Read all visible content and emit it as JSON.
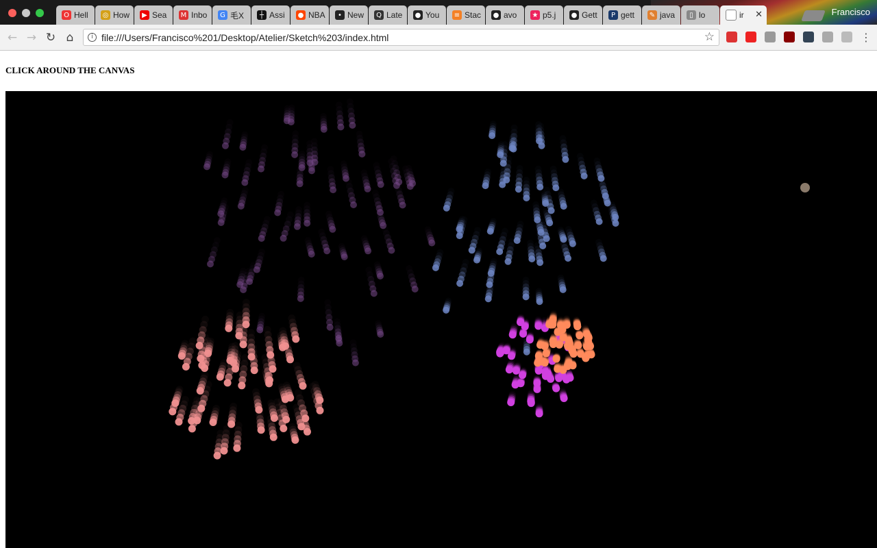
{
  "window": {
    "profile_name": "Francisco",
    "tabs": [
      {
        "label": "Hell",
        "icon": "opera-icon",
        "color": "#e33"
      },
      {
        "label": "How",
        "icon": "globe-icon",
        "color": "#d4a017"
      },
      {
        "label": "Sea",
        "icon": "youtube-icon",
        "color": "#e00"
      },
      {
        "label": "Inbo",
        "icon": "gmail-icon",
        "color": "#d33"
      },
      {
        "label": "毛X",
        "icon": "google-icon",
        "color": "#4285f4"
      },
      {
        "label": "Assi",
        "icon": "cross-icon",
        "color": "#111"
      },
      {
        "label": "NBA",
        "icon": "reddit-icon",
        "color": "#ff4500"
      },
      {
        "label": "New",
        "icon": "dot-icon",
        "color": "#222"
      },
      {
        "label": "Late",
        "icon": "quora-icon",
        "color": "#333"
      },
      {
        "label": "You",
        "icon": "github-icon",
        "color": "#222"
      },
      {
        "label": "Stac",
        "icon": "stackoverflow-icon",
        "color": "#f48024"
      },
      {
        "label": "avo",
        "icon": "github-icon",
        "color": "#222"
      },
      {
        "label": "p5.j",
        "icon": "star-icon",
        "color": "#ed225d"
      },
      {
        "label": "Gett",
        "icon": "github-icon",
        "color": "#222"
      },
      {
        "label": "gett",
        "icon": "p-icon",
        "color": "#1a3a6b"
      },
      {
        "label": "java",
        "icon": "pen-icon",
        "color": "#e08030"
      },
      {
        "label": "lo",
        "icon": "file-icon",
        "color": "#888"
      }
    ],
    "active_tab": {
      "label": "ir",
      "icon": "file-icon"
    }
  },
  "toolbar": {
    "url": "file:///Users/Francisco%201/Desktop/Atelier/Sketch%203/index.html",
    "extensions": [
      {
        "icon": "shield-extension-icon",
        "color": "#d33"
      },
      {
        "icon": "play-extension-icon",
        "color": "#e22"
      },
      {
        "icon": "chat-extension-icon",
        "color": "#999"
      },
      {
        "icon": "ublock-extension-icon",
        "color": "#800"
      },
      {
        "icon": "camera-extension-icon",
        "color": "#345"
      },
      {
        "icon": "puzzle-extension-icon",
        "color": "#aaa"
      },
      {
        "icon": "card-extension-icon",
        "color": "#bbb"
      }
    ]
  },
  "page": {
    "heading": "CLICK AROUND THE CANVAS",
    "canvas_background": "#000000"
  },
  "fireworks": [
    {
      "name": "violet-burst",
      "color": "#7a4a8c"
    },
    {
      "name": "blue-burst",
      "color": "#6e86c4"
    },
    {
      "name": "salmon-burst",
      "color": "#f09090"
    },
    {
      "name": "magenta-burst",
      "color": "#d040e0"
    },
    {
      "name": "orange-burst",
      "color": "#ff8a5c"
    },
    {
      "name": "lone-spark",
      "color": "#8a7a6a"
    }
  ]
}
